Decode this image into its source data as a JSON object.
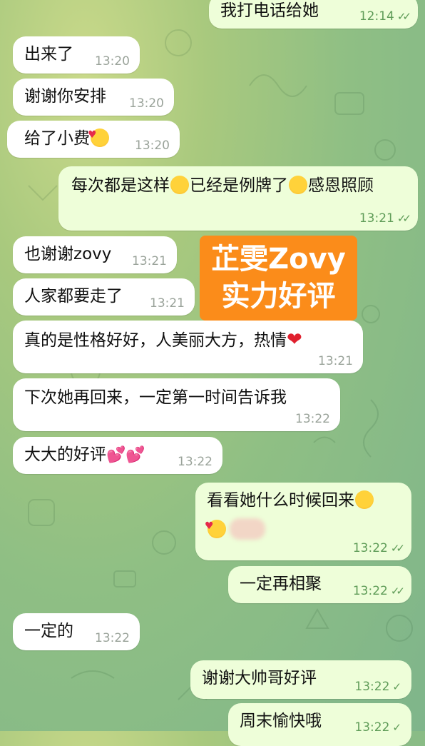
{
  "overlay": {
    "line1": "芷雯Zovy",
    "line2": "实力好评"
  },
  "messages": [
    {
      "id": "m0",
      "dir": "out",
      "text": "我打电话给她",
      "time": "12:14",
      "status": "read"
    },
    {
      "id": "m1",
      "dir": "in",
      "text": "出来了",
      "time": "13:20"
    },
    {
      "id": "m2",
      "dir": "in",
      "text": "谢谢你安排",
      "time": "13:20"
    },
    {
      "id": "m3",
      "dir": "in",
      "text": "给了小费",
      "emoji_after": "smiling-face-with-hearts",
      "time": "13:20"
    },
    {
      "id": "m4",
      "dir": "out",
      "text_a": "每次都是这样",
      "text_b": "已经是例牌了",
      "text_c": "感恩照顾",
      "emoji_a": "grinning-squinting-face",
      "emoji_b": "pleading-face",
      "time": "13:21",
      "status": "read"
    },
    {
      "id": "m5",
      "dir": "in",
      "text": "也谢谢zovy",
      "time": "13:21"
    },
    {
      "id": "m6",
      "dir": "in",
      "text": "人家都要走了",
      "time": "13:21"
    },
    {
      "id": "m7",
      "dir": "in",
      "text": "真的是性格好好，人美丽大方，热情",
      "emoji_after": "red-heart",
      "time": "13:21"
    },
    {
      "id": "m8",
      "dir": "in",
      "text": "下次她再回来，一定第一时间告诉我",
      "time": "13:22"
    },
    {
      "id": "m9",
      "dir": "in",
      "text": "大大的好评",
      "emoji_after": "two-hearts",
      "time": "13:22"
    },
    {
      "id": "m10",
      "dir": "out",
      "text": "看看她什么时候回来",
      "emoji_after": "smiling-face-relieved",
      "emoji_line2": "smiling-face-with-hearts",
      "time": "13:22",
      "status": "read"
    },
    {
      "id": "m11",
      "dir": "out",
      "text": "一定再相聚",
      "time": "13:22",
      "status": "read"
    },
    {
      "id": "m12",
      "dir": "in",
      "text": "一定的",
      "time": "13:22"
    },
    {
      "id": "m13",
      "dir": "out",
      "text": "谢谢大帅哥好评",
      "time": "13:22",
      "status": "sent"
    },
    {
      "id": "m14",
      "dir": "out",
      "text": "周末愉快哦",
      "time": "13:22",
      "status": "sent"
    }
  ],
  "colors": {
    "incoming_bubble": "#ffffff",
    "outgoing_bubble": "#eefed9",
    "time_outgoing": "#5f9c58",
    "time_incoming": "#9aa39a",
    "overlay_badge": "#fb8c1a",
    "wallpaper": "#8fbf84"
  }
}
